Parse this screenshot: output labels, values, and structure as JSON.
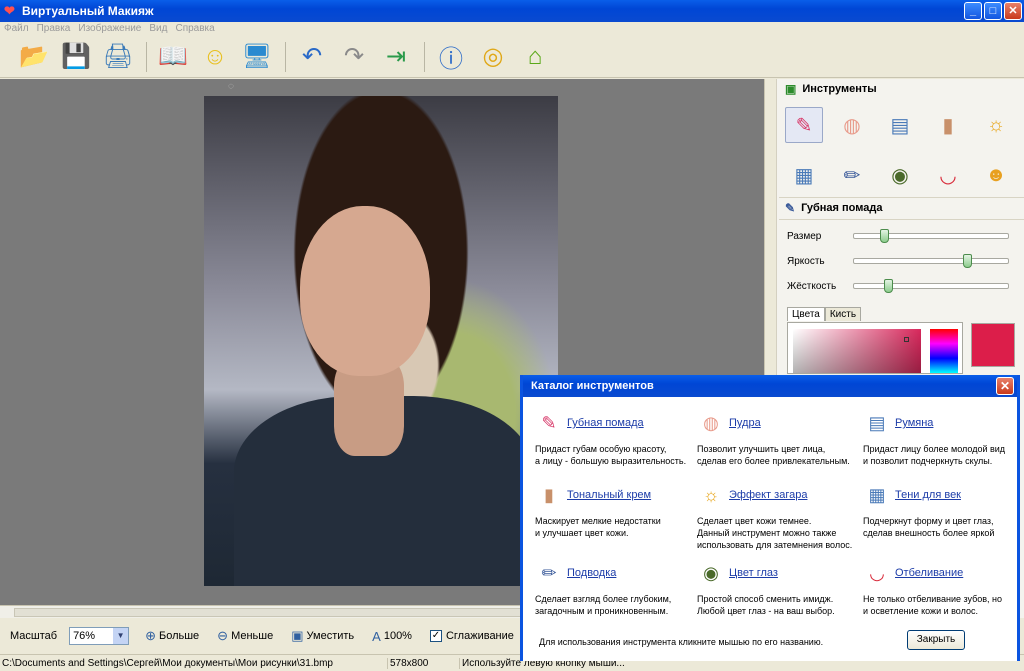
{
  "window": {
    "title": "Виртуальный Макияж",
    "btn_min": "_",
    "btn_max": "□",
    "btn_close": "✕"
  },
  "menu": [
    "Файл",
    "Правка",
    "Изображение",
    "Вид",
    "Справка"
  ],
  "toolbar": [
    "open-icon",
    "save-icon",
    "print-icon",
    "book-icon",
    "smile-icon",
    "monitor-icon",
    "undo-icon",
    "redo-icon",
    "export-icon",
    "info-icon",
    "coins-icon",
    "home-icon"
  ],
  "panel": {
    "tools_title": "Инструменты",
    "tools": [
      "lipstick-icon",
      "powder-icon",
      "blush-icon",
      "foundation-icon",
      "tan-icon",
      "eyeshadow-icon",
      "eyeliner-icon",
      "eye-color-icon",
      "whitening-icon",
      "person-icon"
    ],
    "selected_title": "Губная помада",
    "sliders": [
      {
        "label": "Размер",
        "value": 0.18
      },
      {
        "label": "Яркость",
        "value": 0.76
      },
      {
        "label": "Жёсткость",
        "value": 0.21
      }
    ],
    "tab_colors": "Цвета",
    "tab_brush": "Кисть",
    "swatch_color": "#dc1e4a"
  },
  "zoombar": {
    "label": "Масштаб",
    "zoom_value": "76%",
    "bigger": "Больше",
    "smaller": "Меньше",
    "fit": "Уместить",
    "hundred": "100%",
    "smoothing": "Сглаживание",
    "smoothing_checked": true
  },
  "status": {
    "path": "C:\\Documents and Settings\\Сергей\\Мои документы\\Мои рисунки\\31.bmp",
    "size": "578x800",
    "hint": "Используйте левую кнопку мыши..."
  },
  "dialog": {
    "title": "Каталог инструментов",
    "items": [
      {
        "icon": "lipstick-icon",
        "name": "Губная помада",
        "desc": [
          "Придаст губам особую красоту,",
          "а лицу - большую выразительность."
        ]
      },
      {
        "icon": "powder-icon",
        "name": "Пудра",
        "desc": [
          "Позволит улучшить цвет лица,",
          "сделав его более привлекательным."
        ]
      },
      {
        "icon": "blush-icon",
        "name": "Румяна",
        "desc": [
          "Придаст лицу более молодой вид",
          "и позволит подчеркнуть скулы."
        ]
      },
      {
        "icon": "foundation-icon",
        "name": "Тональный крем",
        "desc": [
          "Маскирует мелкие недостатки",
          "и улучшает цвет кожи."
        ]
      },
      {
        "icon": "tan-icon",
        "name": "Эффект загара",
        "desc": [
          "Сделает цвет кожи темнее.",
          "Данный инструмент можно также",
          "использовать для затемнения волос."
        ]
      },
      {
        "icon": "eyeshadow-icon",
        "name": "Тени для век",
        "desc": [
          "Подчеркнут форму и цвет глаз,",
          "сделав внешность более яркой"
        ]
      },
      {
        "icon": "eyeliner-icon",
        "name": "Подводка",
        "desc": [
          "Сделает взгляд более глубоким,",
          "загадочным и проникновенным."
        ]
      },
      {
        "icon": "eye-color-icon",
        "name": "Цвет глаз",
        "desc": [
          "Простой способ сменить имидж.",
          "Любой цвет глаз - на ваш выбор."
        ]
      },
      {
        "icon": "whitening-icon",
        "name": "Отбеливание",
        "desc": [
          "Не только отбеливание зубов, но",
          "и осветление кожи и волос."
        ]
      }
    ],
    "footer": "Для использования инструмента кликните мышью по его названию.",
    "close_label": "Закрыть"
  }
}
